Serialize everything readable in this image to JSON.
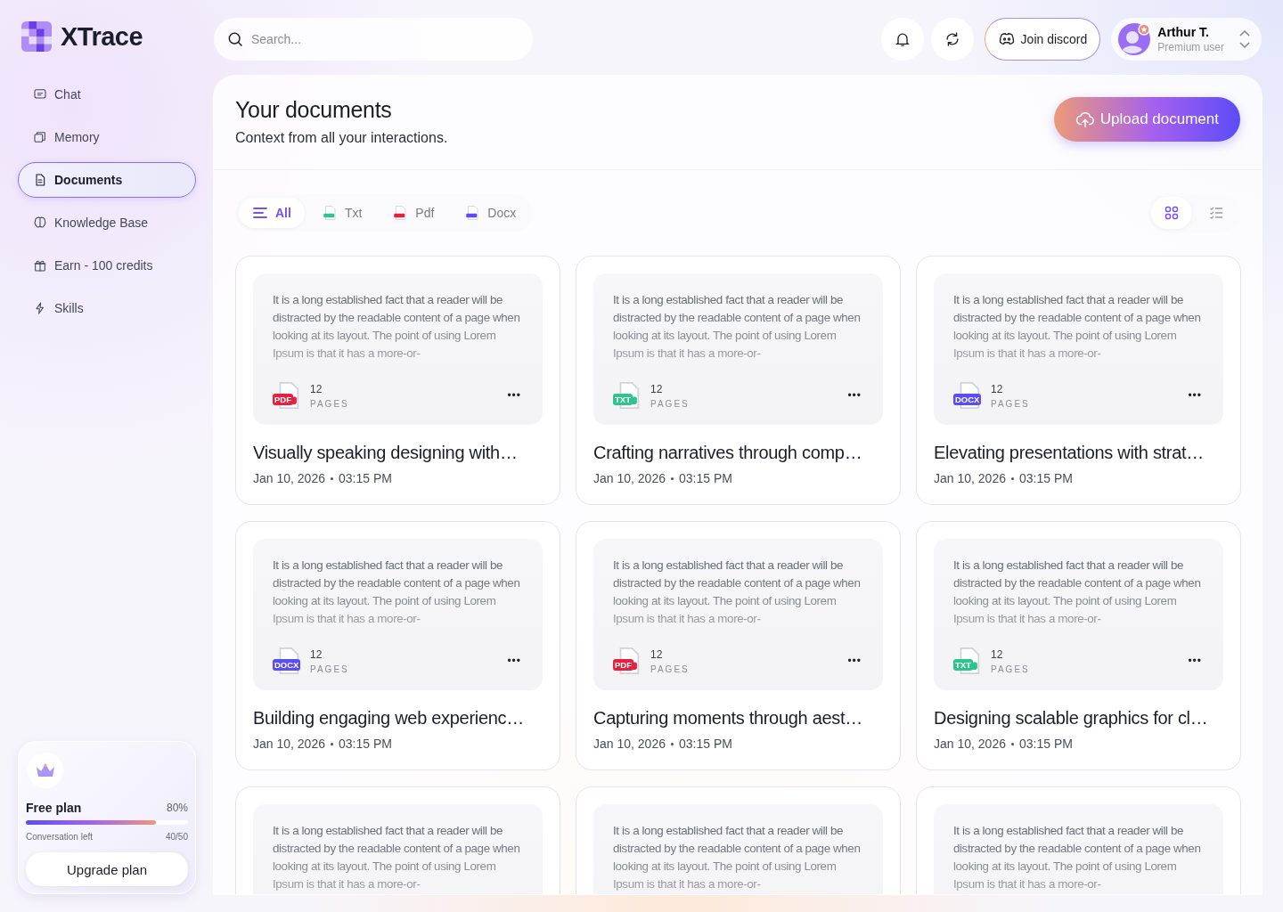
{
  "brand": {
    "name": "XTrace"
  },
  "nav": [
    {
      "label": "Chat",
      "selected": false
    },
    {
      "label": "Memory",
      "selected": false
    },
    {
      "label": "Documents",
      "selected": true
    },
    {
      "label": "Knowledge Base",
      "selected": false
    },
    {
      "label": "Earn - 100 credits",
      "selected": false
    },
    {
      "label": "Skills",
      "selected": false
    }
  ],
  "plan": {
    "name": "Free plan",
    "percent": "80%",
    "level": 0.8,
    "usage_label": "Conversation left",
    "usage": "40/50",
    "button": "Upgrade plan"
  },
  "search": {
    "placeholder": "Search..."
  },
  "discord_button": "Join discord",
  "user": {
    "name": "Arthur T.",
    "role": "Premium user"
  },
  "page": {
    "title": "Your documents",
    "subtitle": "Context from all your interactions.",
    "upload_button": "Upload document"
  },
  "filters": [
    {
      "label": "All",
      "kind": "all",
      "selected": true
    },
    {
      "label": "Txt",
      "kind": "txt",
      "selected": false
    },
    {
      "label": "Pdf",
      "kind": "pdf",
      "selected": false
    },
    {
      "label": "Docx",
      "kind": "docx",
      "selected": false
    }
  ],
  "views": [
    {
      "kind": "grid",
      "selected": true
    },
    {
      "kind": "list",
      "selected": false
    }
  ],
  "documents": [
    {
      "preview": "It is a long established fact that a reader will be distracted by the readable content of a page when looking at its layout. The point of using Lorem Ipsum is that it has a more-or-",
      "kind": "pdf",
      "badge": "PDF",
      "pages": "12",
      "pages_label": "PAGES",
      "more": "•••",
      "title": "Visually speaking designing with…",
      "date": "Jan 10, 2026",
      "time": "03:15 PM"
    },
    {
      "preview": "It is a long established fact that a reader will be distracted by the readable content of a page when looking at its layout. The point of using Lorem Ipsum is that it has a more-or-",
      "kind": "txt",
      "badge": "TXT",
      "pages": "12",
      "pages_label": "PAGES",
      "more": "•••",
      "title": "Crafting narratives through comp…",
      "date": "Jan 10, 2026",
      "time": "03:15 PM"
    },
    {
      "preview": "It is a long established fact that a reader will be distracted by the readable content of a page when looking at its layout. The point of using Lorem Ipsum is that it has a more-or-",
      "kind": "docx",
      "badge": "DOCX",
      "pages": "12",
      "pages_label": "PAGES",
      "more": "•••",
      "title": "Elevating presentations with strat…",
      "date": "Jan 10, 2026",
      "time": "03:15 PM"
    },
    {
      "preview": "It is a long established fact that a reader will be distracted by the readable content of a page when looking at its layout. The point of using Lorem Ipsum is that it has a more-or-",
      "kind": "docx",
      "badge": "DOCX",
      "pages": "12",
      "pages_label": "PAGES",
      "more": "•••",
      "title": "Building engaging web experienc…",
      "date": "Jan 10, 2026",
      "time": "03:15 PM"
    },
    {
      "preview": "It is a long established fact that a reader will be distracted by the readable content of a page when looking at its layout. The point of using Lorem Ipsum is that it has a more-or-",
      "kind": "pdf",
      "badge": "PDF",
      "pages": "12",
      "pages_label": "PAGES",
      "more": "•••",
      "title": "Capturing moments through aest…",
      "date": "Jan 10, 2026",
      "time": "03:15 PM"
    },
    {
      "preview": "It is a long established fact that a reader will be distracted by the readable content of a page when looking at its layout. The point of using Lorem Ipsum is that it has a more-or-",
      "kind": "txt",
      "badge": "TXT",
      "pages": "12",
      "pages_label": "PAGES",
      "more": "•••",
      "title": "Designing scalable graphics for cl…",
      "date": "Jan 10, 2026",
      "time": "03:15 PM"
    },
    {
      "preview": "It is a long established fact that a reader will be distracted by the readable content of a page when looking at its layout. The point of using Lorem Ipsum is that it has a more-or-"
    },
    {
      "preview": "It is a long established fact that a reader will be distracted by the readable content of a page when looking at its layout. The point of using Lorem Ipsum is that it has a more-or-"
    },
    {
      "preview": "It is a long established fact that a reader will be distracted by the readable content of a page when looking at its layout. The point of using Lorem Ipsum is that it has a more-or-"
    }
  ]
}
